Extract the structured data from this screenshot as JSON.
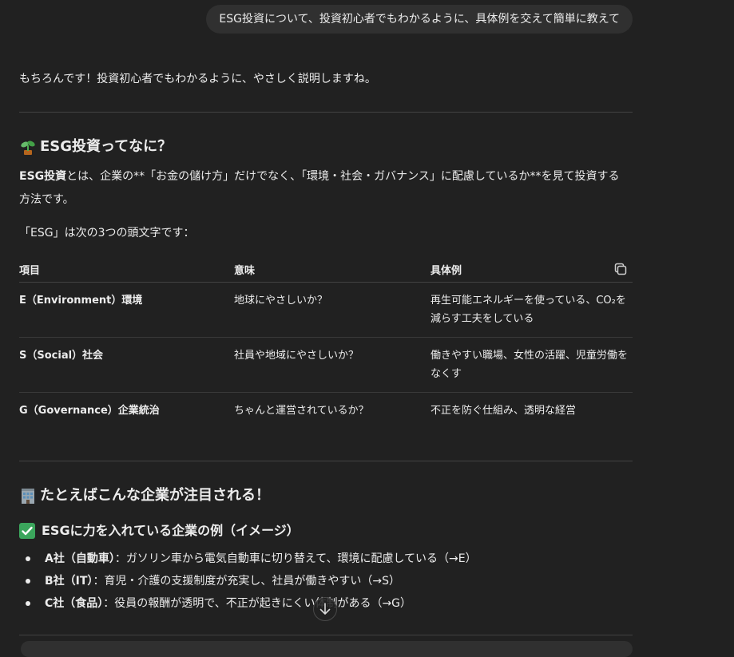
{
  "user_message": "ESG投資について、投資初心者でもわかるように、具体例を交えて簡単に教えて",
  "assistant": {
    "intro": "もちろんです！投資初心者でもわかるように、やさしく説明しますね。",
    "section1": {
      "emoji": "seedling-icon",
      "heading": "ESG投資ってなに？",
      "def_bold": "ESG投資",
      "def_rest": "とは、企業の**「お金の儲け方」だけでなく、「環境・社会・ガバナンス」に配慮しているか**を見て投資する方法です。",
      "esg_line": "「ESG」は次の3つの頭文字です："
    },
    "table": {
      "headers": [
        "項目",
        "意味",
        "具体例"
      ],
      "rows": [
        {
          "item": "E（Environment）環境",
          "meaning": "地球にやさしいか？",
          "example": "再生可能エネルギーを使っている、CO₂を減らす工夫をしている"
        },
        {
          "item": "S（Social）社会",
          "meaning": "社員や地域にやさしいか？",
          "example": "働きやすい職場、女性の活躍、児童労働をなくす"
        },
        {
          "item": "G（Governance）企業統治",
          "meaning": "ちゃんと運営されているか？",
          "example": "不正を防ぐ仕組み、透明な経営"
        }
      ]
    },
    "section2": {
      "emoji": "office-building-icon",
      "heading": "たとえばこんな企業が注目される！",
      "subheading": "ESGに力を入れている企業の例（イメージ）",
      "items": [
        {
          "bold": "A社（自動車）",
          "rest": "：ガソリン車から電気自動車に切り替えて、環境に配慮している（→E）"
        },
        {
          "bold": "B社（IT）",
          "rest": "：育児・介護の支援制度が充実し、社員が働きやすい（→S）"
        },
        {
          "bold": "C社（食品）",
          "rest": "：役員の報酬が透明で、不正が起きにくい体制がある（→G）"
        }
      ]
    }
  },
  "colors": {
    "background": "#212121",
    "user_bubble": "#303030",
    "text": "#ececec",
    "check_green": "#3ba55c"
  }
}
